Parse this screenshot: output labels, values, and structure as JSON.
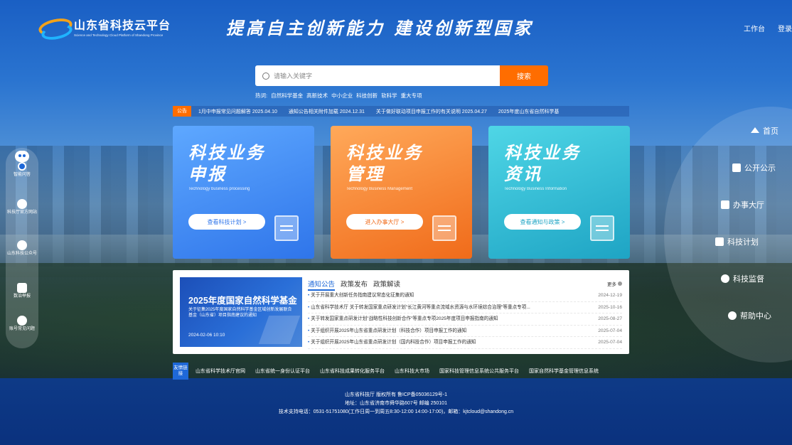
{
  "header": {
    "logo_title": "山东省科技云平台",
    "logo_subtitle": "Science and Technology Cloud Platform of Shandong Province",
    "slogan": "提高自主创新能力 建设创新型国家",
    "links": [
      "工作台",
      "登录"
    ]
  },
  "search": {
    "placeholder": "请输入关键字",
    "button": "搜索",
    "hot_label": "热词:",
    "hot_words": [
      "自然科学基金",
      "高新技术",
      "中小企业",
      "科技创新",
      "软科学",
      "重大专项"
    ]
  },
  "notice": {
    "tag": "公告",
    "items": [
      "1月中申报常见问题解答 2025.04.10",
      "通知公告相关附件加载 2024.12.31",
      "关于做好联动项目申报工作的有关说明 2025.04.27",
      "2025年度山东省自然科学基"
    ]
  },
  "cards": [
    {
      "title_line1": "科技业务",
      "title_line2": "申报",
      "subtitle": "Technology business processing",
      "button": "查看科技计划 >"
    },
    {
      "title_line1": "科技业务",
      "title_line2": "管理",
      "subtitle": "Technology Business Management",
      "button": "进入办事大厅 >"
    },
    {
      "title_line1": "科技业务",
      "title_line2": "资讯",
      "subtitle": "Technology Business Information",
      "button": "查看通知与政策 >"
    }
  ],
  "news": {
    "banner": {
      "title": "2025年度国家自然科学基金",
      "desc": "关于征集2025年度国家自然科学基金区域创新发展联合基金（山东省）项目指南建议的通知",
      "date": "2024-02-06 10:10"
    },
    "tabs": [
      "通知公告",
      "政策发布",
      "政策解读"
    ],
    "more": "更多",
    "rows": [
      {
        "title": "关于开展重大创新任务指南建议常态化征集的通知",
        "date": "2024-12-19"
      },
      {
        "title": "山东省科学技术厅 关于转发国家重点研发计划\"长江黄河等重点流域水资源与水环境综合治理\"等重点专项...",
        "date": "2025-10-16"
      },
      {
        "title": "关于转发国家重点研发计划\"战略性科技创新合作\"等重点专项2025年度项目申报指南的通知",
        "date": "2025-08-27"
      },
      {
        "title": "关于组织开展2025年山东省重点研发计划（科技合作）项目申报工作的通知",
        "date": "2025-07-04"
      },
      {
        "title": "关于组织开展2025年山东省重点研发计划（国内科技合作）项目申报工作的通知",
        "date": "2025-07-04"
      }
    ]
  },
  "links": {
    "tag": "友情链接",
    "items": [
      "山东省科学技术厅官网",
      "山东省统一身份认证平台",
      "山东省科技成果转化服务平台",
      "山东科技大市场",
      "国家科技管理信息系统公共服务平台",
      "国家自然科学基金管理信息系统"
    ]
  },
  "footer": {
    "line1": "山东省科技厅 版权所有 鲁ICP备05036129号-1",
    "line2": "地址：山东省济南市舜华路607号 邮编 250101",
    "line3": "技术支持电话：0531-51751080(工作日周一到周五8:30-12:00 14:00-17:00)，邮箱：kjtcloud@shandong.cn"
  },
  "left_rail": [
    "智能问答",
    "科技厅官方网站",
    "山东科技公众号",
    "数治举报",
    "账号常见问题"
  ],
  "right_nav": [
    "首页",
    "公开公示",
    "办事大厅",
    "科技计划",
    "科技监督",
    "帮助中心"
  ]
}
